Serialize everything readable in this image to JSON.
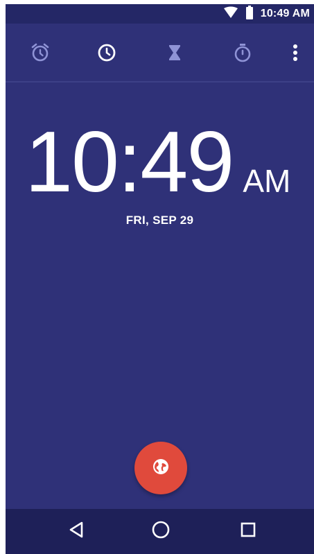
{
  "status_bar": {
    "time": "10:49 AM",
    "wifi_icon": "wifi-icon",
    "battery_icon": "battery-icon"
  },
  "tabs": [
    {
      "name": "alarm",
      "icon": "alarm-icon"
    },
    {
      "name": "clock",
      "icon": "clock-icon"
    },
    {
      "name": "timer",
      "icon": "hourglass-icon"
    },
    {
      "name": "stopwatch",
      "icon": "stopwatch-icon"
    }
  ],
  "overflow_menu_icon": "more-vert-icon",
  "clock": {
    "time": "10:49",
    "ampm": "AM",
    "date": "FRI, SEP 29"
  },
  "fab": {
    "icon": "globe-icon",
    "color": "#e04a3c"
  },
  "nav_bar": {
    "back_icon": "back-triangle-icon",
    "home_icon": "home-circle-icon",
    "recents_icon": "recents-square-icon"
  },
  "colors": {
    "background": "#2f3178",
    "status_bar": "#242766",
    "nav_bar": "#1e2058",
    "tab_icon": "#8f93d6",
    "tab_icon_active": "#ffffff",
    "fab": "#e04a3c"
  }
}
